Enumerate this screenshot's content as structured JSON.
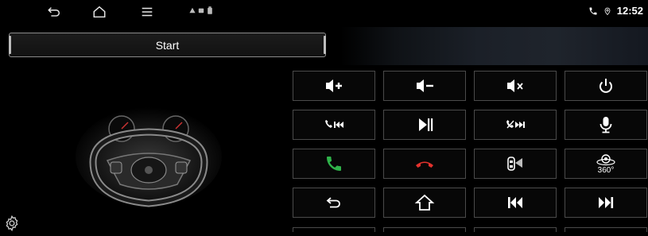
{
  "status_bar": {
    "time": "12:52",
    "nav_icons": [
      "back-icon",
      "home-icon",
      "menu-icon"
    ],
    "notification_icons": [
      "warning-icon",
      "card-icon",
      "battery-icon"
    ],
    "right_icons": [
      "phone-icon",
      "location-icon"
    ]
  },
  "start_button": {
    "label": "Start"
  },
  "keys": [
    {
      "name": "volume-up-key",
      "icon": "volume-up-icon"
    },
    {
      "name": "volume-down-key",
      "icon": "volume-down-icon"
    },
    {
      "name": "mute-key",
      "icon": "mute-icon"
    },
    {
      "name": "power-key",
      "icon": "power-icon"
    },
    {
      "name": "call-previous-key",
      "icon": "call-previous-icon"
    },
    {
      "name": "play-pause-key",
      "icon": "play-pause-icon"
    },
    {
      "name": "hangup-next-key",
      "icon": "hangup-next-icon"
    },
    {
      "name": "mic-key",
      "icon": "mic-icon"
    },
    {
      "name": "answer-call-key",
      "icon": "phone-answer-icon",
      "color": "#2fb34a"
    },
    {
      "name": "end-call-key",
      "icon": "phone-hangup-icon",
      "color": "#e5322d"
    },
    {
      "name": "car-door-key",
      "icon": "car-door-icon"
    },
    {
      "name": "camera-360-key",
      "icon": "camera-360-icon",
      "label": "360°"
    },
    {
      "name": "back-key",
      "icon": "back-icon"
    },
    {
      "name": "home-key",
      "icon": "home-icon"
    },
    {
      "name": "previous-track-key",
      "icon": "previous-track-icon"
    },
    {
      "name": "next-track-key",
      "icon": "next-track-icon"
    }
  ],
  "colors": {
    "accent_green": "#2fb34a",
    "accent_red": "#e5322d",
    "key_border": "#4a4a4a"
  }
}
